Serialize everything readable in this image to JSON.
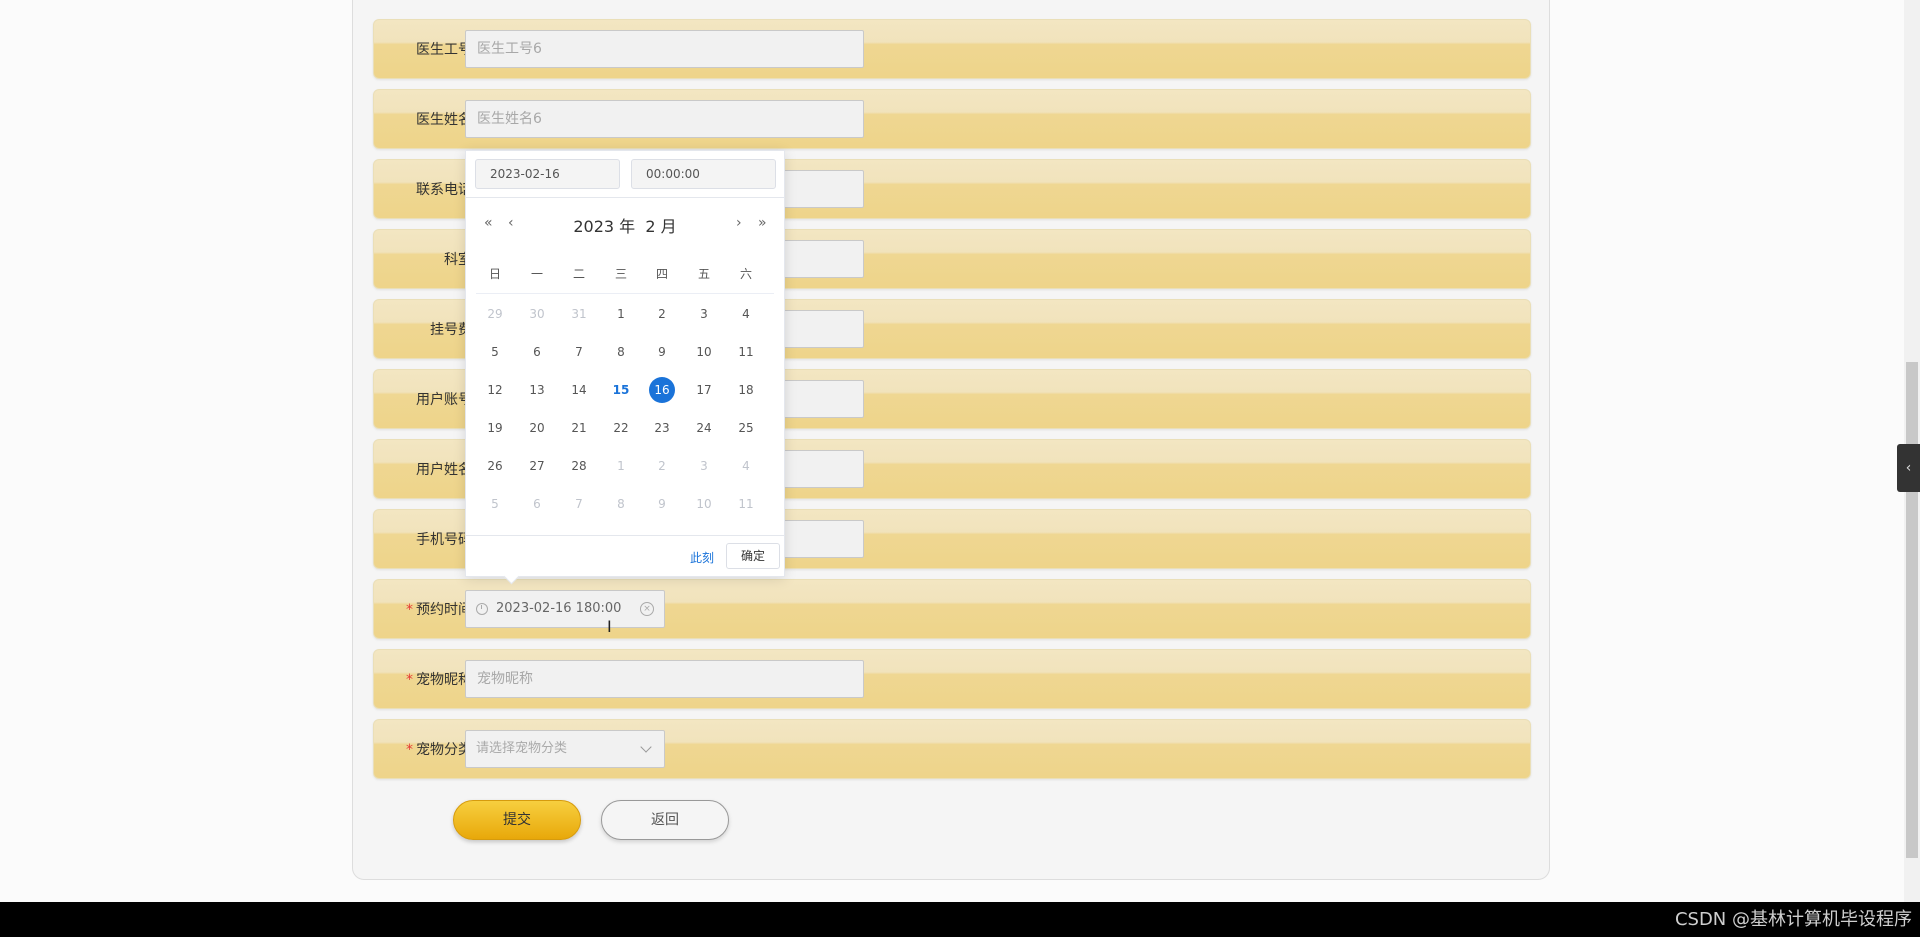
{
  "form": {
    "rows": [
      {
        "label": "医生工号",
        "placeholder": "医生工号6",
        "required": false
      },
      {
        "label": "医生姓名",
        "placeholder": "医生姓名6",
        "required": false
      },
      {
        "label": "联系电话",
        "placeholder": "",
        "required": false
      },
      {
        "label": "科室",
        "placeholder": "",
        "required": false
      },
      {
        "label": "挂号费",
        "placeholder": "",
        "required": false
      },
      {
        "label": "用户账号",
        "placeholder": "",
        "required": false
      },
      {
        "label": "用户姓名",
        "placeholder": "",
        "required": false
      },
      {
        "label": "手机号码",
        "placeholder": "",
        "required": false
      }
    ],
    "appointment": {
      "label": "预约时间",
      "value": "2023-02-16 180:00"
    },
    "pet_name": {
      "label": "宠物昵称",
      "placeholder": "宠物昵称"
    },
    "pet_category": {
      "label": "宠物分类",
      "placeholder": "请选择宠物分类"
    },
    "required_mark": "*",
    "submit_label": "提交",
    "back_label": "返回"
  },
  "picker": {
    "date_value": "2023-02-16",
    "time_value": "00:00:00",
    "year": "2023 年",
    "month": "2 月",
    "nav": {
      "prev_year": "«",
      "prev_month": "‹",
      "next_month": "›",
      "next_year": "»"
    },
    "weekdays": [
      "日",
      "一",
      "二",
      "三",
      "四",
      "五",
      "六"
    ],
    "weeks": [
      [
        {
          "d": "29",
          "t": "other"
        },
        {
          "d": "30",
          "t": "other"
        },
        {
          "d": "31",
          "t": "other"
        },
        {
          "d": "1",
          "t": ""
        },
        {
          "d": "2",
          "t": ""
        },
        {
          "d": "3",
          "t": ""
        },
        {
          "d": "4",
          "t": ""
        }
      ],
      [
        {
          "d": "5",
          "t": ""
        },
        {
          "d": "6",
          "t": ""
        },
        {
          "d": "7",
          "t": ""
        },
        {
          "d": "8",
          "t": ""
        },
        {
          "d": "9",
          "t": ""
        },
        {
          "d": "10",
          "t": ""
        },
        {
          "d": "11",
          "t": ""
        }
      ],
      [
        {
          "d": "12",
          "t": ""
        },
        {
          "d": "13",
          "t": ""
        },
        {
          "d": "14",
          "t": ""
        },
        {
          "d": "15",
          "t": "today"
        },
        {
          "d": "16",
          "t": "sel"
        },
        {
          "d": "17",
          "t": ""
        },
        {
          "d": "18",
          "t": ""
        }
      ],
      [
        {
          "d": "19",
          "t": ""
        },
        {
          "d": "20",
          "t": ""
        },
        {
          "d": "21",
          "t": ""
        },
        {
          "d": "22",
          "t": ""
        },
        {
          "d": "23",
          "t": ""
        },
        {
          "d": "24",
          "t": ""
        },
        {
          "d": "25",
          "t": ""
        }
      ],
      [
        {
          "d": "26",
          "t": ""
        },
        {
          "d": "27",
          "t": ""
        },
        {
          "d": "28",
          "t": ""
        },
        {
          "d": "1",
          "t": "other"
        },
        {
          "d": "2",
          "t": "other"
        },
        {
          "d": "3",
          "t": "other"
        },
        {
          "d": "4",
          "t": "other"
        }
      ],
      [
        {
          "d": "5",
          "t": "other"
        },
        {
          "d": "6",
          "t": "other"
        },
        {
          "d": "7",
          "t": "other"
        },
        {
          "d": "8",
          "t": "other"
        },
        {
          "d": "9",
          "t": "other"
        },
        {
          "d": "10",
          "t": "other"
        },
        {
          "d": "11",
          "t": "other"
        }
      ]
    ],
    "now_label": "此刻",
    "ok_label": "确定"
  },
  "watermark": "CSDN @基林计算机毕设程序",
  "colors": {
    "accent": "#1a73d9",
    "row_top": "#f3e6c2",
    "row_bottom": "#eed48a",
    "submit": "#efbb1f"
  }
}
